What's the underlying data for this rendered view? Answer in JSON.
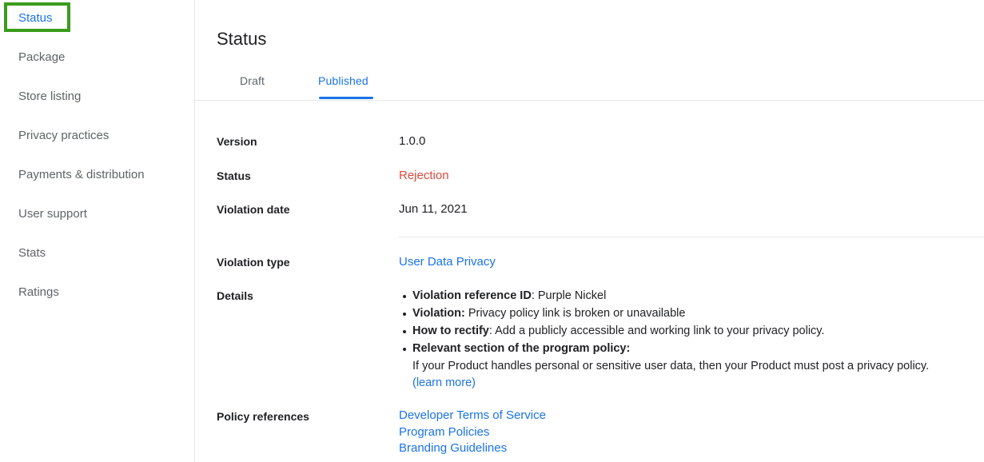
{
  "sidebar": {
    "items": [
      {
        "label": "Status",
        "active": true
      },
      {
        "label": "Package",
        "active": false
      },
      {
        "label": "Store listing",
        "active": false
      },
      {
        "label": "Privacy practices",
        "active": false
      },
      {
        "label": "Payments & distribution",
        "active": false
      },
      {
        "label": "User support",
        "active": false
      },
      {
        "label": "Stats",
        "active": false
      },
      {
        "label": "Ratings",
        "active": false
      }
    ]
  },
  "main": {
    "title": "Status",
    "tabs": [
      {
        "label": "Draft",
        "active": false
      },
      {
        "label": "Published",
        "active": true
      }
    ],
    "fields": {
      "version_label": "Version",
      "version_value": "1.0.0",
      "status_label": "Status",
      "status_value": "Rejection",
      "violation_date_label": "Violation date",
      "violation_date_value": "Jun 11, 2021",
      "violation_type_label": "Violation type",
      "violation_type_value": "User Data Privacy",
      "details_label": "Details",
      "policy_references_label": "Policy references"
    },
    "details": {
      "bullet1_term": "Violation reference ID",
      "bullet1_sep": ": ",
      "bullet1_text": "Purple Nickel",
      "bullet2_term": "Violation:",
      "bullet2_text": " Privacy policy link is broken or unavailable",
      "bullet3_term": "How to rectify",
      "bullet3_sep": ": ",
      "bullet3_text": "Add a publicly accessible and working link to your privacy policy.",
      "bullet4_term": "Relevant section of the program policy:",
      "bullet4_body": "If your Product handles personal or sensitive user data, then your Product must post a privacy policy.",
      "bullet4_link": "(learn more)"
    },
    "policy_references": [
      "Developer Terms of Service",
      "Program Policies",
      "Branding Guidelines"
    ]
  },
  "annotation": {
    "highlight_target": "Status",
    "highlight_color": "#3a9c1c"
  },
  "colors": {
    "link": "#1a73e8",
    "rejection": "#e0483a",
    "text": "#202124",
    "muted": "#5f6368",
    "rule": "#e4e6e8"
  }
}
